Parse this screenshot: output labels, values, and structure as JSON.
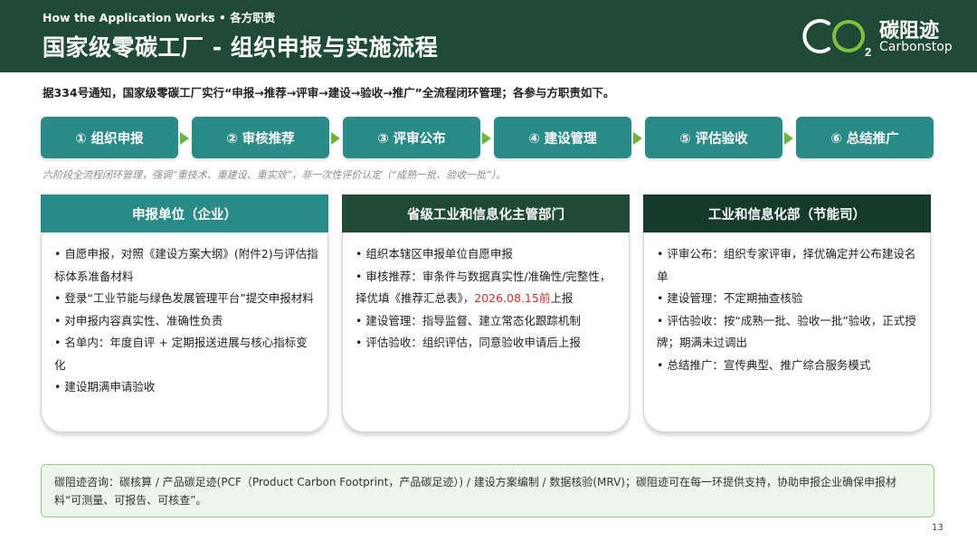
{
  "header": {
    "kicker": "How the Application Works • 各方职责",
    "title": "国家级零碳工厂 - 组织申报与实施流程",
    "logo_cn": "碳阻迹",
    "logo_en": "Carbonstop",
    "logo_sub": "2"
  },
  "intro": "据334号通知，国家级零碳工厂实行“申报→推荐→评审→建设→验收→推广”全流程闭环管理；各参与方职责如下。",
  "steps": [
    {
      "label": "① 组织申报"
    },
    {
      "label": "② 审核推荐"
    },
    {
      "label": "③ 评审公布"
    },
    {
      "label": "④ 建设管理"
    },
    {
      "label": "⑤ 评估验收"
    },
    {
      "label": "⑥ 总结推广"
    }
  ],
  "note": "六阶段全流程闭环管理，强调“重技术、重建设、重实效”，非一次性评价认定（“成熟一批、验收一批”）。",
  "cards": [
    {
      "title": "申报单位（企业）",
      "items": [
        "自愿申报，对照《建设方案大纲》(附件2)与评估指标体系准备材料",
        "登录“工业节能与绿色发展管理平台”提交申报材料",
        "对申报内容真实性、准确性负责",
        "名单内：年度自评 + 定期报送进展与核心指标变化",
        "建设期满申请验收"
      ]
    },
    {
      "title": "省级工业和信息化主管部门",
      "items": [
        "组织本辖区申报单位自愿申报",
        "审核推荐：审条件与数据真实性/准确性/完整性，择优填《推荐汇总表》，",
        "建设管理：指导监督、建立常态化跟踪机制",
        "评估验收：组织评估，同意验收申请后上报"
      ],
      "deadline": "2026.08.15前",
      "deadline_suffix": "上报"
    },
    {
      "title": "工业和信息化部（节能司）",
      "items": [
        "评审公布：组织专家评审，择优确定并公布建设名单",
        "建设管理：不定期抽查核验",
        "评估验收：按“成熟一批、验收一批”验收，正式授牌；期满未过调出",
        "总结推广：宣传典型、推广综合服务模式"
      ]
    }
  ],
  "footer": "碳阻迹咨询：碳核算 / 产品碳足迹(PCF（Product Carbon Footprint，产品碳足迹）) / 建设方案编制 / 数据核验(MRV)；碳阻迹可在每一环提供支持，协助申报企业确保申报材料“可测量、可报告、可核查”。",
  "page_number": "13",
  "colors": {
    "header_bg": "#1f4a36",
    "step_bg": "#2a8a87",
    "arrow": "#6db33f",
    "card1_head": "#2a8a87",
    "card2_head": "#1f4a36",
    "card3_head": "#143b2b",
    "highlight": "#d0312d"
  }
}
